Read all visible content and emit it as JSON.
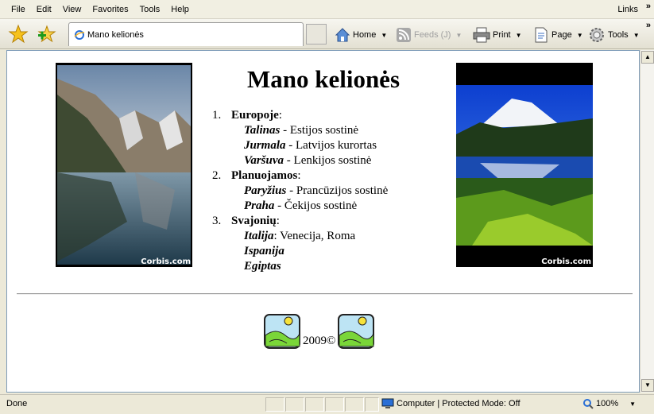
{
  "menu": {
    "items": [
      "File",
      "Edit",
      "View",
      "Favorites",
      "Tools",
      "Help"
    ],
    "links_label": "Links",
    "more_glyph": "»"
  },
  "toolbar": {
    "tab_title": "Mano kelionės",
    "home_label": "Home",
    "feeds_label": "Feeds (J)",
    "print_label": "Print",
    "page_label": "Page",
    "tools_label": "Tools",
    "more_glyph": "»"
  },
  "page": {
    "title": "Mano kelionės",
    "sections": [
      {
        "number": "1.",
        "heading": "Europoje",
        "items": [
          {
            "name": "Talinas",
            "sep": " - ",
            "desc": "Estijos sostinė"
          },
          {
            "name": "Jurmala",
            "sep": " - ",
            "desc": "Latvijos kurortas"
          },
          {
            "name": "Varšuva",
            "sep": " - ",
            "desc": "Lenkijos sostinė"
          }
        ]
      },
      {
        "number": "2.",
        "heading": "Planuojamos",
        "items": [
          {
            "name": "Paryžius",
            "sep": " - ",
            "desc": "Prancūzijos sostinė"
          },
          {
            "name": "Praha",
            "sep": " - ",
            "desc": "Čekijos sostinė"
          }
        ]
      },
      {
        "number": "3.",
        "heading": "Svajonių",
        "items": [
          {
            "name": "Italija",
            "sep": ": ",
            "desc": "Venecija, Roma"
          },
          {
            "name": "Ispanija",
            "sep": "",
            "desc": ""
          },
          {
            "name": "Egiptas",
            "sep": "",
            "desc": ""
          }
        ]
      }
    ],
    "photo_credit_left": "Corbis.com",
    "photo_credit_right": "Corbis.com",
    "footer_text": "2009©"
  },
  "status": {
    "text": "Done",
    "zone": "Computer | Protected Mode: Off",
    "zoom": "100%"
  },
  "colors": {
    "chrome": "#ece9d8",
    "content_bg": "#ffffff",
    "ie_blue": "#2a6fd6"
  },
  "icons": [
    "favorites-star-icon",
    "add-favorite-icon",
    "ie-page-icon",
    "home-icon",
    "feeds-icon",
    "print-icon",
    "page-icon",
    "tools-gear-icon",
    "computer-icon",
    "zoom-icon"
  ]
}
